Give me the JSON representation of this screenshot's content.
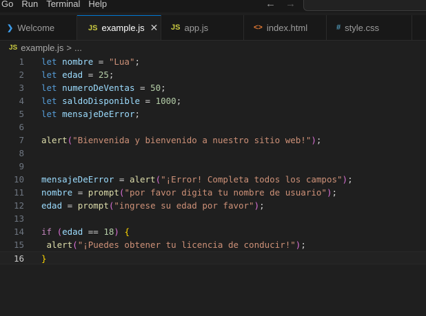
{
  "menu": [
    "Go",
    "Run",
    "Terminal",
    "Help"
  ],
  "tabs": [
    {
      "label": "Welcome",
      "icon": "vscode-icon",
      "active": false
    },
    {
      "label": "example.js",
      "icon": "js-icon",
      "active": true
    },
    {
      "label": "app.js",
      "icon": "js-icon",
      "active": false
    },
    {
      "label": "index.html",
      "icon": "html-icon",
      "active": false
    },
    {
      "label": "style.css",
      "icon": "css-icon",
      "active": false
    }
  ],
  "tab_icons": {
    "js": "JS",
    "html": "<>",
    "css": "#"
  },
  "breadcrumb": {
    "file": "example.js",
    "separator": ">",
    "rest": "..."
  },
  "editor": {
    "current_line": 16,
    "line_numbers": [
      "1",
      "2",
      "3",
      "4",
      "5",
      "6",
      "7",
      "8",
      "9",
      "10",
      "11",
      "12",
      "13",
      "14",
      "15",
      "16"
    ],
    "lines": [
      "let nombre = \"Lua\";",
      "let edad = 25;",
      "let numeroDeVentas = 50;",
      "let saldoDisponible = 1000;",
      "let mensajeDeError;",
      "",
      "alert(\"Bienvenida y bienvenido a nuestro sitio web!\");",
      "",
      "",
      "mensajeDeError = alert(\"¡Error! Completa todos los campos\");",
      "nombre = prompt(\"por favor digita tu nombre de usuario\");",
      "edad = prompt(\"ingrese su edad por favor\");",
      "",
      "if (edad == 18) {",
      " alert(\"¡Puedes obtener tu licencia de conducir!\");",
      "}"
    ]
  },
  "colors": {
    "keyword": "#569cd6",
    "variable": "#9cdcfe",
    "string": "#ce9178",
    "number": "#b5cea8",
    "function": "#dcdcaa",
    "control": "#c586c0",
    "accent": "#0078d4"
  }
}
